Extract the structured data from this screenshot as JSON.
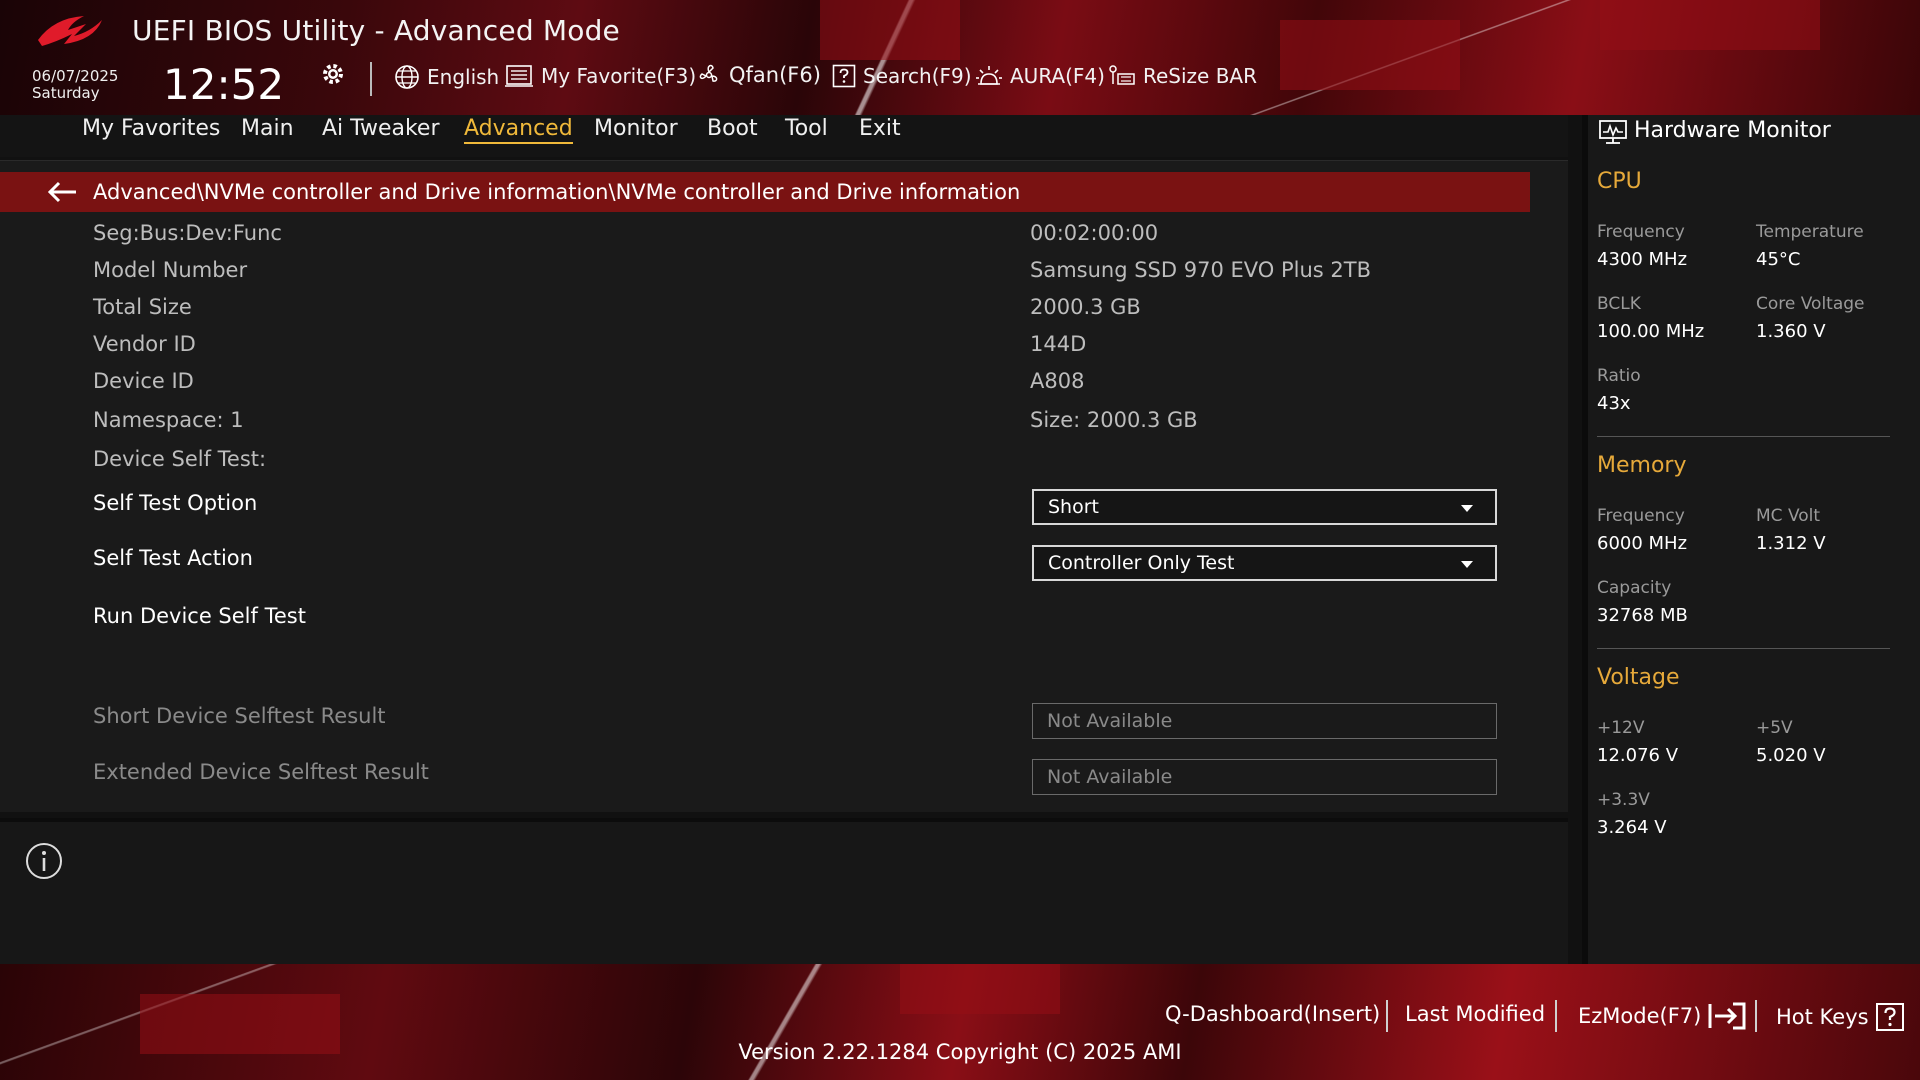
{
  "header": {
    "title": "UEFI BIOS Utility - Advanced Mode",
    "date": "06/07/2025",
    "day": "Saturday",
    "time": "12:52",
    "toolbar": {
      "language": "English",
      "favorite": "My Favorite(F3)",
      "qfan": "Qfan(F6)",
      "search": "Search(F9)",
      "aura": "AURA(F4)",
      "resize_bar": "ReSize BAR"
    }
  },
  "menu": {
    "items": [
      "My Favorites",
      "Main",
      "Ai Tweaker",
      "Advanced",
      "Monitor",
      "Boot",
      "Tool",
      "Exit"
    ],
    "active": "Advanced"
  },
  "breadcrumb": "Advanced\\NVMe controller and Drive information\\NVMe controller and Drive information",
  "info": [
    {
      "label": "Seg:Bus:Dev:Func",
      "value": "00:02:00:00"
    },
    {
      "label": "Model Number",
      "value": "Samsung SSD 970 EVO Plus 2TB"
    },
    {
      "label": "Total Size",
      "value": "2000.3 GB"
    },
    {
      "label": "Vendor ID",
      "value": "144D"
    },
    {
      "label": "Device ID",
      "value": "A808"
    },
    {
      "label": "Namespace: 1",
      "value": "Size: 2000.3 GB"
    },
    {
      "label": "Device Self Test:",
      "value": ""
    }
  ],
  "self_test": {
    "option_label": "Self Test Option",
    "option_value": "Short",
    "action_label": "Self Test Action",
    "action_value": "Controller Only Test",
    "run_label": "Run Device Self Test",
    "short_result_label": "Short Device Selftest Result",
    "short_result_value": "Not Available",
    "extended_result_label": "Extended Device Selftest Result",
    "extended_result_value": "Not Available"
  },
  "hardware_monitor": {
    "title": "Hardware Monitor",
    "cpu": {
      "section": "CPU",
      "frequency_label": "Frequency",
      "frequency": "4300 MHz",
      "temperature_label": "Temperature",
      "temperature": "45°C",
      "bclk_label": "BCLK",
      "bclk": "100.00 MHz",
      "core_voltage_label": "Core Voltage",
      "core_voltage": "1.360 V",
      "ratio_label": "Ratio",
      "ratio": "43x"
    },
    "memory": {
      "section": "Memory",
      "frequency_label": "Frequency",
      "frequency": "6000 MHz",
      "mc_volt_label": "MC Volt",
      "mc_volt": "1.312 V",
      "capacity_label": "Capacity",
      "capacity": "32768 MB"
    },
    "voltage": {
      "section": "Voltage",
      "v12_label": "+12V",
      "v12": "12.076 V",
      "v5_label": "+5V",
      "v5": "5.020 V",
      "v33_label": "+3.3V",
      "v33": "3.264 V"
    }
  },
  "footer": {
    "q_dashboard": "Q-Dashboard(Insert)",
    "last_modified": "Last Modified",
    "ezmode": "EzMode(F7)",
    "hot_keys": "Hot Keys",
    "version": "Version 2.22.1284 Copyright (C) 2025 AMI"
  },
  "colors": {
    "accent": "#f0b93a",
    "breadcrumb_bar": "#7a1212",
    "section_heading": "#e6a93a"
  },
  "icons": [
    "rog-logo",
    "gear-icon",
    "globe-icon",
    "favorite-list-icon",
    "fan-icon",
    "help-box-icon",
    "aura-icon",
    "resize-bar-icon",
    "back-arrow-icon",
    "info-icon",
    "monitor-icon",
    "exit-arrow-icon",
    "question-box-icon"
  ]
}
